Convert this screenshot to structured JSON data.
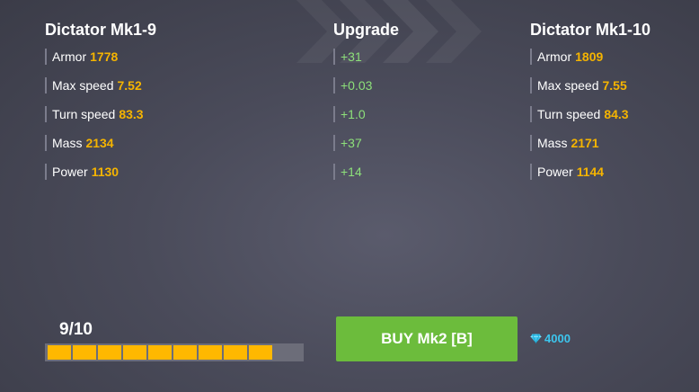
{
  "colors": {
    "stat_value": "#f5b400",
    "upgrade_value": "#8de07a",
    "buy_button": "#6cbc3c",
    "progress_fill": "#ffb800",
    "diamond": "#3cc6ee"
  },
  "current": {
    "title": "Dictator Mk1-9",
    "stats": [
      {
        "label": "Armor",
        "value": "1778"
      },
      {
        "label": "Max speed",
        "value": "7.52"
      },
      {
        "label": "Turn speed",
        "value": "83.3"
      },
      {
        "label": "Mass",
        "value": "2134"
      },
      {
        "label": "Power",
        "value": "1130"
      }
    ]
  },
  "upgrade": {
    "title": "Upgrade",
    "values": [
      "+31",
      "+0.03",
      "+1.0",
      "+37",
      "+14"
    ]
  },
  "next": {
    "title": "Dictator Mk1-10",
    "stats": [
      {
        "label": "Armor",
        "value": "1809"
      },
      {
        "label": "Max speed",
        "value": "7.55"
      },
      {
        "label": "Turn speed",
        "value": "84.3"
      },
      {
        "label": "Mass",
        "value": "2171"
      },
      {
        "label": "Power",
        "value": "1144"
      }
    ]
  },
  "progress": {
    "label": "9/10",
    "filled": 9,
    "total": 10
  },
  "buy_button": {
    "label": "BUY Mk2 [B]"
  },
  "price": {
    "icon": "diamond-icon",
    "value": "4000"
  }
}
